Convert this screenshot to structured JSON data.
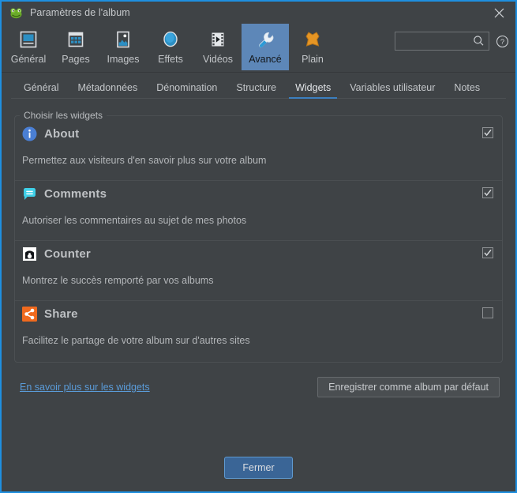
{
  "window": {
    "title": "Paramètres de l'album",
    "app_icon": "frog-icon",
    "close_icon": "close-icon",
    "border_color": "#1e8fe0"
  },
  "toolbar": {
    "items": [
      {
        "label": "Général",
        "icon": "monitor-icon",
        "selected": false
      },
      {
        "label": "Pages",
        "icon": "grid-icon",
        "selected": false
      },
      {
        "label": "Images",
        "icon": "picture-icon",
        "selected": false
      },
      {
        "label": "Effets",
        "icon": "circle-icon",
        "selected": false
      },
      {
        "label": "Vidéos",
        "icon": "film-icon",
        "selected": false
      },
      {
        "label": "Avancé",
        "icon": "wrench-icon",
        "selected": true
      },
      {
        "label": "Plain",
        "icon": "skin-icon",
        "selected": false
      }
    ],
    "selected_accent": "#5d87b8",
    "search": {
      "value": "",
      "placeholder": "",
      "icon": "search-icon"
    },
    "help": {
      "icon": "help-icon"
    }
  },
  "tabs": {
    "items": [
      {
        "label": "Général",
        "active": false
      },
      {
        "label": "Métadonnées",
        "active": false
      },
      {
        "label": "Dénomination",
        "active": false
      },
      {
        "label": "Structure",
        "active": false
      },
      {
        "label": "Widgets",
        "active": true
      },
      {
        "label": "Variables utilisateur",
        "active": false
      },
      {
        "label": "Notes",
        "active": false
      }
    ],
    "active_underline_color": "#3c7fbf"
  },
  "group": {
    "legend": "Choisir les widgets",
    "widgets": [
      {
        "name": "About",
        "icon": "info-circle-icon",
        "icon_color": "#4a7fd4",
        "description": "Permettez aux visiteurs d'en savoir plus sur votre album",
        "checked": true
      },
      {
        "name": "Comments",
        "icon": "speech-bubble-icon",
        "icon_color": "#3fd0e8",
        "description": "Autoriser les commentaires au sujet de mes photos",
        "checked": true
      },
      {
        "name": "Counter",
        "icon": "counter-icon",
        "icon_color": "#ffffff",
        "description": "Montrez le succès remporté par vos albums",
        "checked": true
      },
      {
        "name": "Share",
        "icon": "share-icon",
        "icon_color": "#f06a1e",
        "description": "Facilitez le partage  de votre album sur d'autres sites",
        "checked": false
      }
    ]
  },
  "bottom": {
    "more_link": "En savoir plus sur les widgets",
    "link_color": "#5a9bd8",
    "save_default_button": "Enregistrer comme album par défaut"
  },
  "footer": {
    "close_button": "Fermer"
  }
}
